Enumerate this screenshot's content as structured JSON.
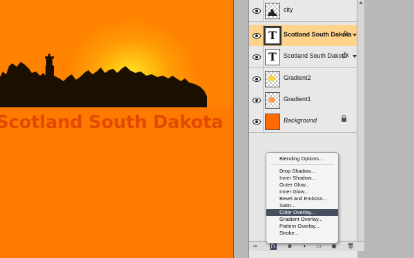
{
  "canvas": {
    "title_text": "Scotland South Dakota"
  },
  "layers": [
    {
      "name": "city",
      "thumb": "checker-city",
      "style": "normal",
      "selected": false
    },
    {
      "name": "Scotland South Dakota",
      "thumb": "text",
      "style": "bold",
      "selected": true,
      "fx": "fx"
    },
    {
      "name": "Scotland South Dakota",
      "thumb": "text",
      "style": "normal",
      "selected": false,
      "fx": "fx"
    },
    {
      "name": "Gradient2",
      "thumb": "checker-yellow",
      "style": "normal",
      "selected": false
    },
    {
      "name": "Gradient1",
      "thumb": "checker-orange",
      "style": "normal",
      "selected": false
    },
    {
      "name": "Background",
      "thumb": "orange",
      "style": "italic",
      "selected": false,
      "locked": true
    }
  ],
  "menu": {
    "items": [
      "Blending Options...",
      "Drop Shadow...",
      "Inner Shadow...",
      "Outer Glow...",
      "Inner Glow...",
      "Bevel and Emboss...",
      "Satin...",
      "Color Overlay...",
      "Gradient Overlay...",
      "Pattern Overlay...",
      "Stroke..."
    ],
    "highlighted": "Color Overlay..."
  },
  "toolbar": {
    "icons": [
      "link-icon",
      "fx-icon",
      "mask-icon",
      "adjustment-icon",
      "group-folder-icon",
      "new-layer-icon",
      "trash-icon"
    ],
    "fx_label": "fx"
  },
  "colors": {
    "canvas_orange": "#ff7d00",
    "title_color": "#e24a00",
    "selected_layer": "#ffd38c",
    "menu_highlight": "#454f5f"
  }
}
